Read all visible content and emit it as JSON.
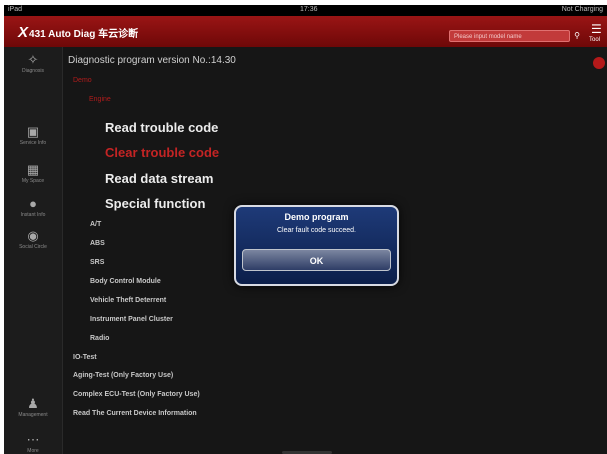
{
  "status_bar": {
    "carrier": "iPad",
    "time": "17:36",
    "right": "Not Charging"
  },
  "header": {
    "logo_x": "X",
    "app_name": "431 Auto Diag 车云诊断",
    "search_placeholder": "Please input model name",
    "toolbar_label": "Tool"
  },
  "sidebar": {
    "items": [
      {
        "label": "Diagnosis",
        "icon": "wrench-icon"
      },
      {
        "label": "Service Info",
        "icon": "folder-icon"
      },
      {
        "label": "My Space",
        "icon": "calendar-icon"
      },
      {
        "label": "Instant Info",
        "icon": "chat-icon"
      },
      {
        "label": "Social Circle",
        "icon": "people-icon"
      },
      {
        "label": "Management",
        "icon": "user-icon"
      },
      {
        "label": "More",
        "icon": "more-icon"
      }
    ]
  },
  "main": {
    "version_text": "Diagnostic program version No.:14.30",
    "breadcrumb": [
      "Demo",
      "Engine"
    ],
    "functions": [
      "Read trouble code",
      "Clear trouble code",
      "Read data stream",
      "Special function"
    ],
    "systems": [
      "A/T",
      "ABS",
      "SRS",
      "Body Control Module",
      "Vehicle Theft Deterrent",
      "Instrument Panel Cluster",
      "Radio"
    ],
    "tests": [
      "IO-Test",
      "Aging-Test (Only Factory Use)",
      "Complex ECU-Test (Only Factory Use)",
      "Read The Current Device Information"
    ]
  },
  "dialog": {
    "title": "Demo program",
    "message": "Clear fault code succeed.",
    "ok_label": "OK"
  },
  "colors": {
    "accent": "#9a1515",
    "active_item": "#c42424",
    "dialog_bg": "#1e3a78",
    "background": "#161616"
  }
}
